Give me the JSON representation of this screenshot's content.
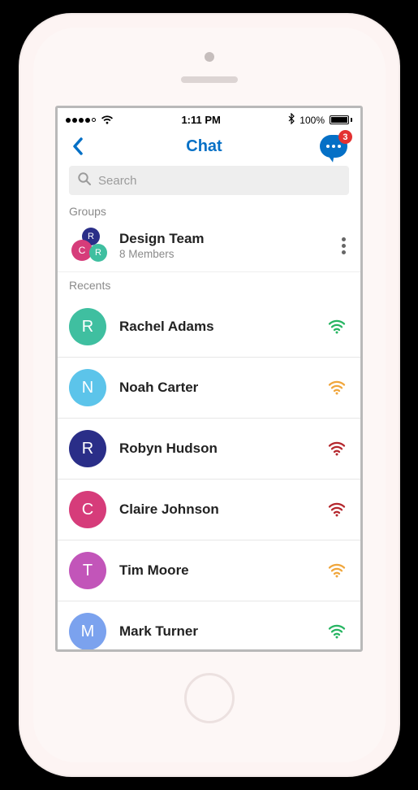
{
  "status_bar": {
    "time": "1:11 PM",
    "battery_text": "100%"
  },
  "nav": {
    "title": "Chat",
    "badge": "3"
  },
  "search": {
    "placeholder": "Search"
  },
  "sections": {
    "groups_label": "Groups",
    "recents_label": "Recents"
  },
  "group": {
    "name": "Design Team",
    "subtitle": "8 Members",
    "avatars": {
      "a1": "R",
      "a2": "C",
      "a3": "R"
    }
  },
  "status_colors": {
    "green": "#27b562",
    "amber": "#f0a63c",
    "red": "#b5282e"
  },
  "contacts": [
    {
      "initial": "R",
      "name": "Rachel Adams",
      "avatar_color": "#3fbfa0",
      "status": "green"
    },
    {
      "initial": "N",
      "name": "Noah Carter",
      "avatar_color": "#5cc4ea",
      "status": "amber"
    },
    {
      "initial": "R",
      "name": "Robyn Hudson",
      "avatar_color": "#2a2e88",
      "status": "red"
    },
    {
      "initial": "C",
      "name": "Claire Johnson",
      "avatar_color": "#d63c7a",
      "status": "red"
    },
    {
      "initial": "T",
      "name": "Tim Moore",
      "avatar_color": "#c255b9",
      "status": "amber"
    },
    {
      "initial": "M",
      "name": "Mark Turner",
      "avatar_color": "#7ba2ee",
      "status": "green"
    }
  ]
}
